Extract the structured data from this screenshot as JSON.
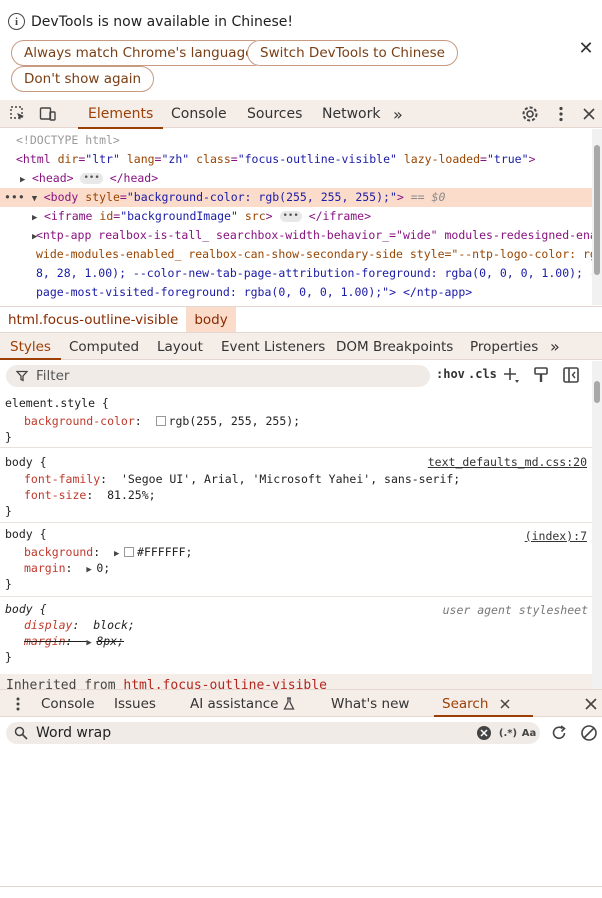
{
  "infobar": {
    "message": "DevTools is now available in Chinese!",
    "buttons": [
      "Always match Chrome's language",
      "Switch DevTools to Chinese",
      "Don't show again"
    ],
    "close_glyph": "✕"
  },
  "main_tabs": {
    "tabs": [
      "Elements",
      "Console",
      "Sources",
      "Network"
    ],
    "active": "Elements",
    "more_glyph": "»"
  },
  "elements_tree": {
    "doctype": "<!DOCTYPE html>",
    "html_open": {
      "tag": "<html",
      "attrs": [
        [
          "dir",
          "\"ltr\""
        ],
        [
          "lang",
          "\"zh\""
        ],
        [
          "class",
          "\"focus-outline-visible\""
        ],
        [
          "lazy-loaded",
          "\"true\""
        ]
      ],
      "close": ">"
    },
    "head": {
      "open": "<head>",
      "close": "</head>"
    },
    "body": {
      "tag": "<body",
      "attr": "style",
      "val": "\"background-color: rgb(255, 255, 255);\"",
      "close": ">",
      "marker": "== $0"
    },
    "iframe": {
      "tag": "<iframe",
      "attr1": "id",
      "val1": "\"backgroundImage\"",
      "attr2": "src",
      "close": "</iframe>"
    },
    "ntp_lines": [
      "<ntp-app realbox-is-tall_ searchbox-width-behavior_=\"wide\" modules-redesigned-enabled_",
      "wide-modules-enabled_ realbox-can-show-secondary-side style=\"--ntp-logo-color: rgba(142, 7",
      "8, 28, 1.00); --color-new-tab-page-attribution-foreground: rgba(0, 0, 0, 1.00); --color-new-tab-",
      "page-most-visited-foreground: rgba(0, 0, 0, 1.00);\"> </ntp-app>"
    ]
  },
  "breadcrumb": [
    "html.focus-outline-visible",
    "body"
  ],
  "styles_tabs": {
    "tabs": [
      "Styles",
      "Computed",
      "Layout",
      "Event Listeners",
      "DOM Breakpoints",
      "Properties"
    ],
    "active": "Styles"
  },
  "filter": {
    "placeholder": "Filter",
    "hov": ":hov",
    "cls": ".cls"
  },
  "rules": {
    "r1": {
      "selector": "element.style {",
      "prop": "background-color",
      "value": "rgb(255, 255, 255);",
      "close": "}"
    },
    "r2": {
      "selector": "body {",
      "source": "text_defaults_md.css:20",
      "p1": "font-family",
      "v1": "'Segoe UI', Arial, 'Microsoft Yahei', sans-serif;",
      "p2": "font-size",
      "v2": "81.25%;",
      "close": "}"
    },
    "r3": {
      "selector": "body {",
      "source": "(index):7",
      "p1": "background",
      "v1": "#FFFFFF;",
      "p2": "margin",
      "v2": "0;",
      "close": "}"
    },
    "r4": {
      "selector": "body {",
      "source": "user agent stylesheet",
      "p1": "display",
      "v1": "block;",
      "p2": "margin",
      "v2": "8px;",
      "close": "}"
    },
    "inherited_label": "Inherited from",
    "inherited_sel": "html.focus-outline-visible"
  },
  "drawer_tabs": {
    "tabs": [
      "Console",
      "Issues",
      "AI assistance",
      "What's new",
      "Search"
    ],
    "active": "Search"
  },
  "search": {
    "value": "Word wrap",
    "regex": "(.*)",
    "case": "Aa"
  },
  "colors": {
    "accent": "#9c3f05",
    "toolbar_bg": "#f5ede8",
    "selected_bg": "#fbdccb"
  }
}
